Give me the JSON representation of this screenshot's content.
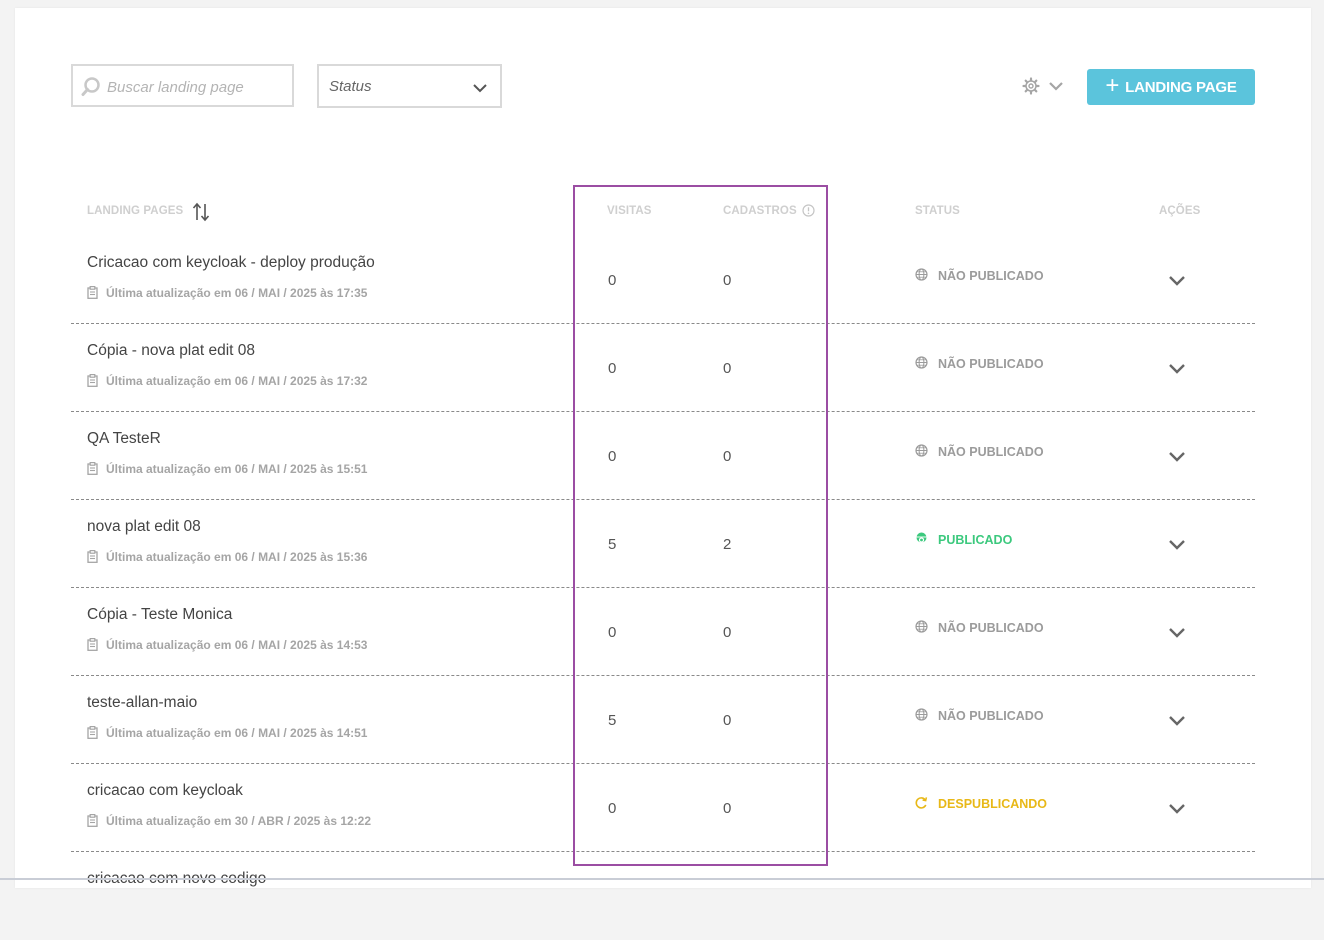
{
  "toolbar": {
    "search_placeholder": "Buscar landing page",
    "status_label": "Status",
    "new_button_label": "LANDING PAGE"
  },
  "table": {
    "headers": {
      "landing_pages": "LANDING PAGES",
      "visits": "VISITAS",
      "registrations": "CADASTROS",
      "status": "STATUS",
      "actions": "AÇÕES"
    },
    "rows": [
      {
        "name": "Cricacao com keycloak - deploy produção",
        "updated": "Última atualização em 06 / MAI / 2025 às 17:35",
        "visits": "0",
        "registrations": "0",
        "status": "NÃO PUBLICADO"
      },
      {
        "name": "Cópia - nova plat edit 08",
        "updated": "Última atualização em 06 / MAI / 2025 às 17:32",
        "visits": "0",
        "registrations": "0",
        "status": "NÃO PUBLICADO"
      },
      {
        "name": "QA TesteR",
        "updated": "Última atualização em 06 / MAI / 2025 às 15:51",
        "visits": "0",
        "registrations": "0",
        "status": "NÃO PUBLICADO"
      },
      {
        "name": "nova plat edit 08",
        "updated": "Última atualização em 06 / MAI / 2025 às 15:36",
        "visits": "5",
        "registrations": "2",
        "status": "PUBLICADO"
      },
      {
        "name": "Cópia - Teste Monica",
        "updated": "Última atualização em 06 / MAI / 2025 às 14:53",
        "visits": "0",
        "registrations": "0",
        "status": "NÃO PUBLICADO"
      },
      {
        "name": "teste-allan-maio",
        "updated": "Última atualização em 06 / MAI / 2025 às 14:51",
        "visits": "5",
        "registrations": "0",
        "status": "NÃO PUBLICADO"
      },
      {
        "name": "cricacao com keycloak",
        "updated": "Última atualização em 30 / ABR / 2025 às 12:22",
        "visits": "0",
        "registrations": "0",
        "status": "DESPUBLICANDO"
      },
      {
        "name": "cricacao com novo codigo",
        "updated": "",
        "visits": "",
        "registrations": "",
        "status": ""
      }
    ]
  },
  "colors": {
    "accent": "#5bc4dc",
    "published": "#3cc97e",
    "unpublishing": "#e8b817",
    "not_published": "#9b9b9b",
    "highlight_box": "#9b4ea3"
  },
  "icons": {
    "search": "search-icon",
    "dropdown": "chevron-down-icon",
    "settings": "gear-icon",
    "add": "plus-icon",
    "sort": "sort-arrows-icon",
    "info": "info-icon",
    "updated": "clipboard-icon",
    "not_published": "globe-icon",
    "published": "published-globe-icon",
    "unpublishing": "refresh-icon",
    "actions": "chevron-down-icon"
  }
}
